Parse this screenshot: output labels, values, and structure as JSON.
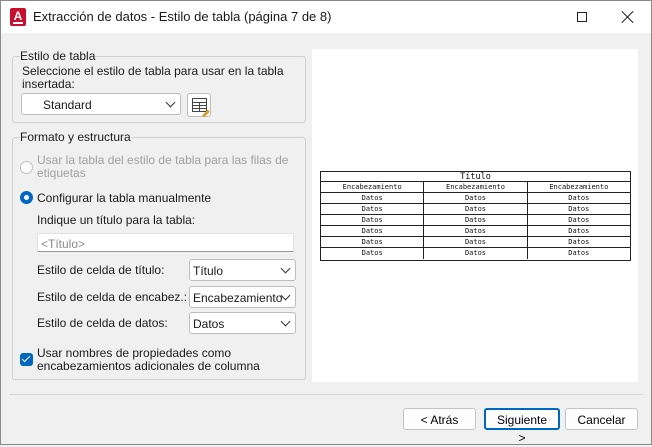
{
  "window": {
    "title": "Extracción de datos - Estilo de tabla (página 7 de 8)",
    "app_icon_letter": "A",
    "icons": {
      "app": "autocad-app-icon",
      "maximize": "maximize-icon",
      "close": "close-icon"
    }
  },
  "table_style": {
    "group_title": "Estilo de tabla",
    "prompt": "Seleccione el estilo de tabla para usar en la tabla insertada:",
    "style_value": "Standard",
    "style_button_icon": "table-style-icon"
  },
  "format": {
    "group_title": "Formato y estructura",
    "option_use_style": "Usar la tabla del estilo de tabla para las filas de etiquetas",
    "option_manual": "Configurar la tabla manualmente",
    "title_prompt": "Indique un título para la tabla:",
    "title_placeholder": "<Título>",
    "title_cell_label": "Estilo de celda de título:",
    "title_cell_value": "Título",
    "header_cell_label": "Estilo de celda de encabez.:",
    "header_cell_value": "Encabezamiento",
    "data_cell_label": "Estilo de celda de datos:",
    "data_cell_value": "Datos",
    "use_prop_names_label": "Usar nombres de propiedades como encabezamientos adicionales de columna",
    "use_prop_names_checked": true,
    "selected_option": "manual"
  },
  "preview": {
    "title": "Título",
    "headers": [
      "Encabezamiento",
      "Encabezamiento",
      "Encabezamiento"
    ],
    "rows": [
      [
        "Datos",
        "Datos",
        "Datos"
      ],
      [
        "Datos",
        "Datos",
        "Datos"
      ],
      [
        "Datos",
        "Datos",
        "Datos"
      ],
      [
        "Datos",
        "Datos",
        "Datos"
      ],
      [
        "Datos",
        "Datos",
        "Datos"
      ],
      [
        "Datos",
        "Datos",
        "Datos"
      ]
    ]
  },
  "footer": {
    "back_label": "< Atrás",
    "next_label": "Siguiente >",
    "cancel_label": "Cancelar"
  },
  "colors": {
    "accent": "#0067c0",
    "app_icon": "#c8102e"
  }
}
